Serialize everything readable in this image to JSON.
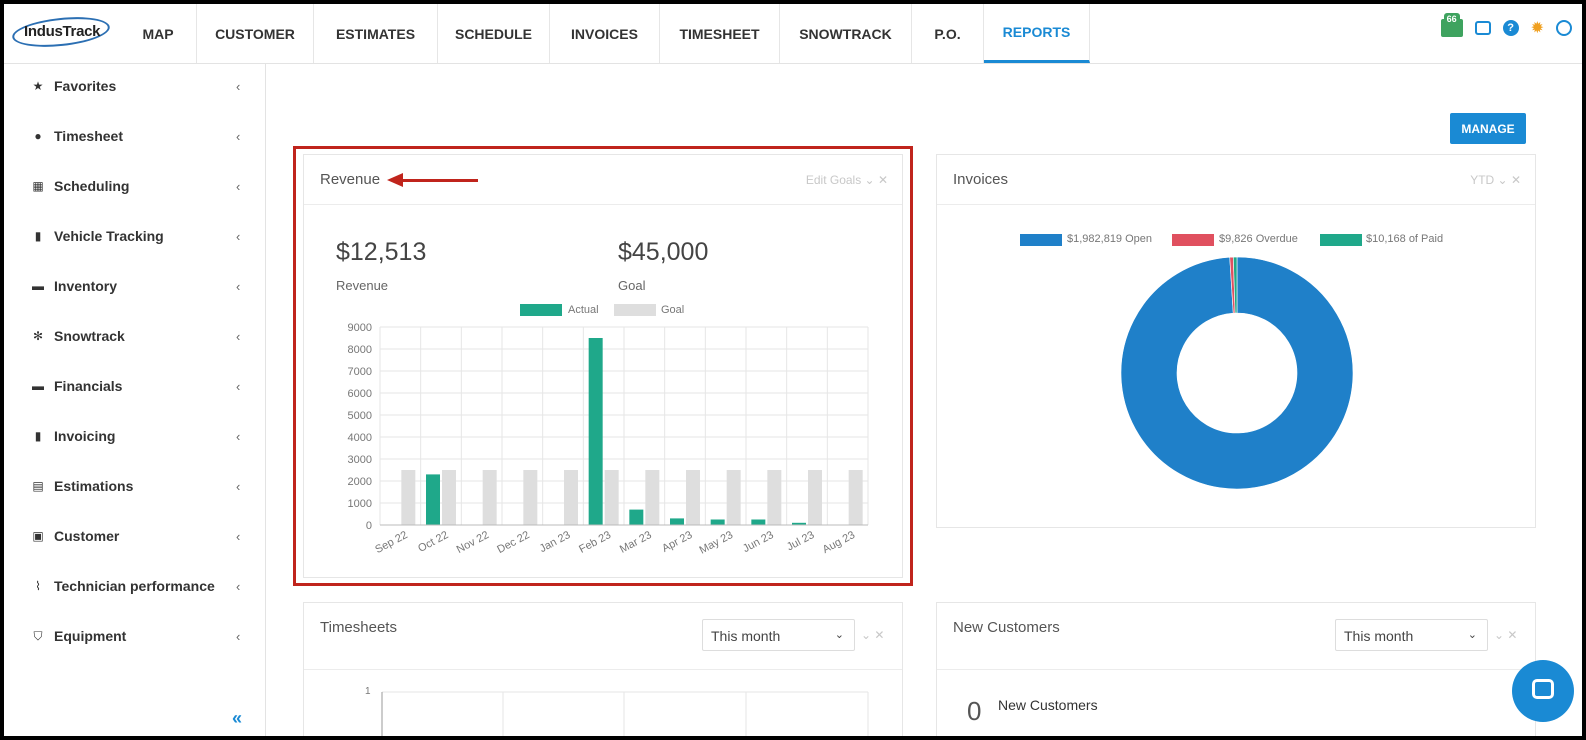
{
  "app": {
    "logo_text": "IndusTrack"
  },
  "nav": {
    "tabs": [
      "MAP",
      "CUSTOMER",
      "ESTIMATES",
      "SCHEDULE",
      "INVOICES",
      "TIMESHEET",
      "SNOWTRACK",
      "P.O.",
      "REPORTS"
    ],
    "active": "REPORTS",
    "notification_count": "66"
  },
  "sidebar": {
    "items": [
      {
        "label": "Favorites",
        "icon": "star-icon",
        "glyph": "★"
      },
      {
        "label": "Timesheet",
        "icon": "clock-icon",
        "glyph": "●"
      },
      {
        "label": "Scheduling",
        "icon": "calendar-icon",
        "glyph": "▦"
      },
      {
        "label": "Vehicle Tracking",
        "icon": "truck-icon",
        "glyph": "▮"
      },
      {
        "label": "Inventory",
        "icon": "warehouse-icon",
        "glyph": "▬"
      },
      {
        "label": "Snowtrack",
        "icon": "snowflake-icon",
        "glyph": "✻"
      },
      {
        "label": "Financials",
        "icon": "money-icon",
        "glyph": "▬"
      },
      {
        "label": "Invoicing",
        "icon": "invoice-icon",
        "glyph": "▮"
      },
      {
        "label": "Estimations",
        "icon": "calculator-icon",
        "glyph": "▤"
      },
      {
        "label": "Customer",
        "icon": "contact-icon",
        "glyph": "▣"
      },
      {
        "label": "Technician performance",
        "icon": "chart-line-icon",
        "glyph": "⌇"
      },
      {
        "label": "Equipment",
        "icon": "shield-icon",
        "glyph": "⛉"
      }
    ],
    "chevron": "‹",
    "collapse": "«"
  },
  "main": {
    "manage_label": "MANAGE",
    "revenue": {
      "title": "Revenue",
      "tools": "Edit Goals ⌄ ✕",
      "revenue_value": "$12,513",
      "revenue_label": "Revenue",
      "goal_value": "$45,000",
      "goal_label": "Goal"
    },
    "invoices": {
      "title": "Invoices",
      "tools": "YTD ⌄ ✕"
    },
    "timesheets": {
      "title": "Timesheets",
      "select_value": "This month",
      "tools": "⌄ ✕",
      "y_tick": "1"
    },
    "new_customers": {
      "title": "New Customers",
      "select_value": "This month",
      "tools": "⌄ ✕",
      "count": "0",
      "count_label": "New Customers"
    }
  },
  "colors": {
    "actual": "#1fa88a",
    "goal": "#dedede",
    "open": "#1f80c9",
    "overdue": "#e0505f",
    "paid": "#1fa88a"
  },
  "chart_data": [
    {
      "type": "bar",
      "categories": [
        "Sep 22",
        "Oct 22",
        "Nov 22",
        "Dec 22",
        "Jan 23",
        "Feb 23",
        "Mar 23",
        "Apr 23",
        "May 23",
        "Jun 23",
        "Jul 23",
        "Aug 23"
      ],
      "series": [
        {
          "name": "Actual",
          "values": [
            0,
            2300,
            0,
            0,
            0,
            8500,
            700,
            300,
            250,
            250,
            100,
            0
          ]
        },
        {
          "name": "Goal",
          "values": [
            2500,
            2500,
            2500,
            2500,
            2500,
            2500,
            2500,
            2500,
            2500,
            2500,
            2500,
            2500
          ]
        }
      ],
      "yticks": [
        0,
        1000,
        2000,
        3000,
        4000,
        5000,
        6000,
        7000,
        8000,
        9000
      ],
      "ylim": [
        0,
        9000
      ],
      "legend_position": "top"
    },
    {
      "type": "pie",
      "donut": true,
      "slices": [
        {
          "label": "$1,982,819 Open",
          "value": 1982819
        },
        {
          "label": "$9,826 Overdue",
          "value": 9826
        },
        {
          "label": "$10,168 of Paid",
          "value": 10168
        }
      ],
      "legend_position": "top"
    }
  ]
}
